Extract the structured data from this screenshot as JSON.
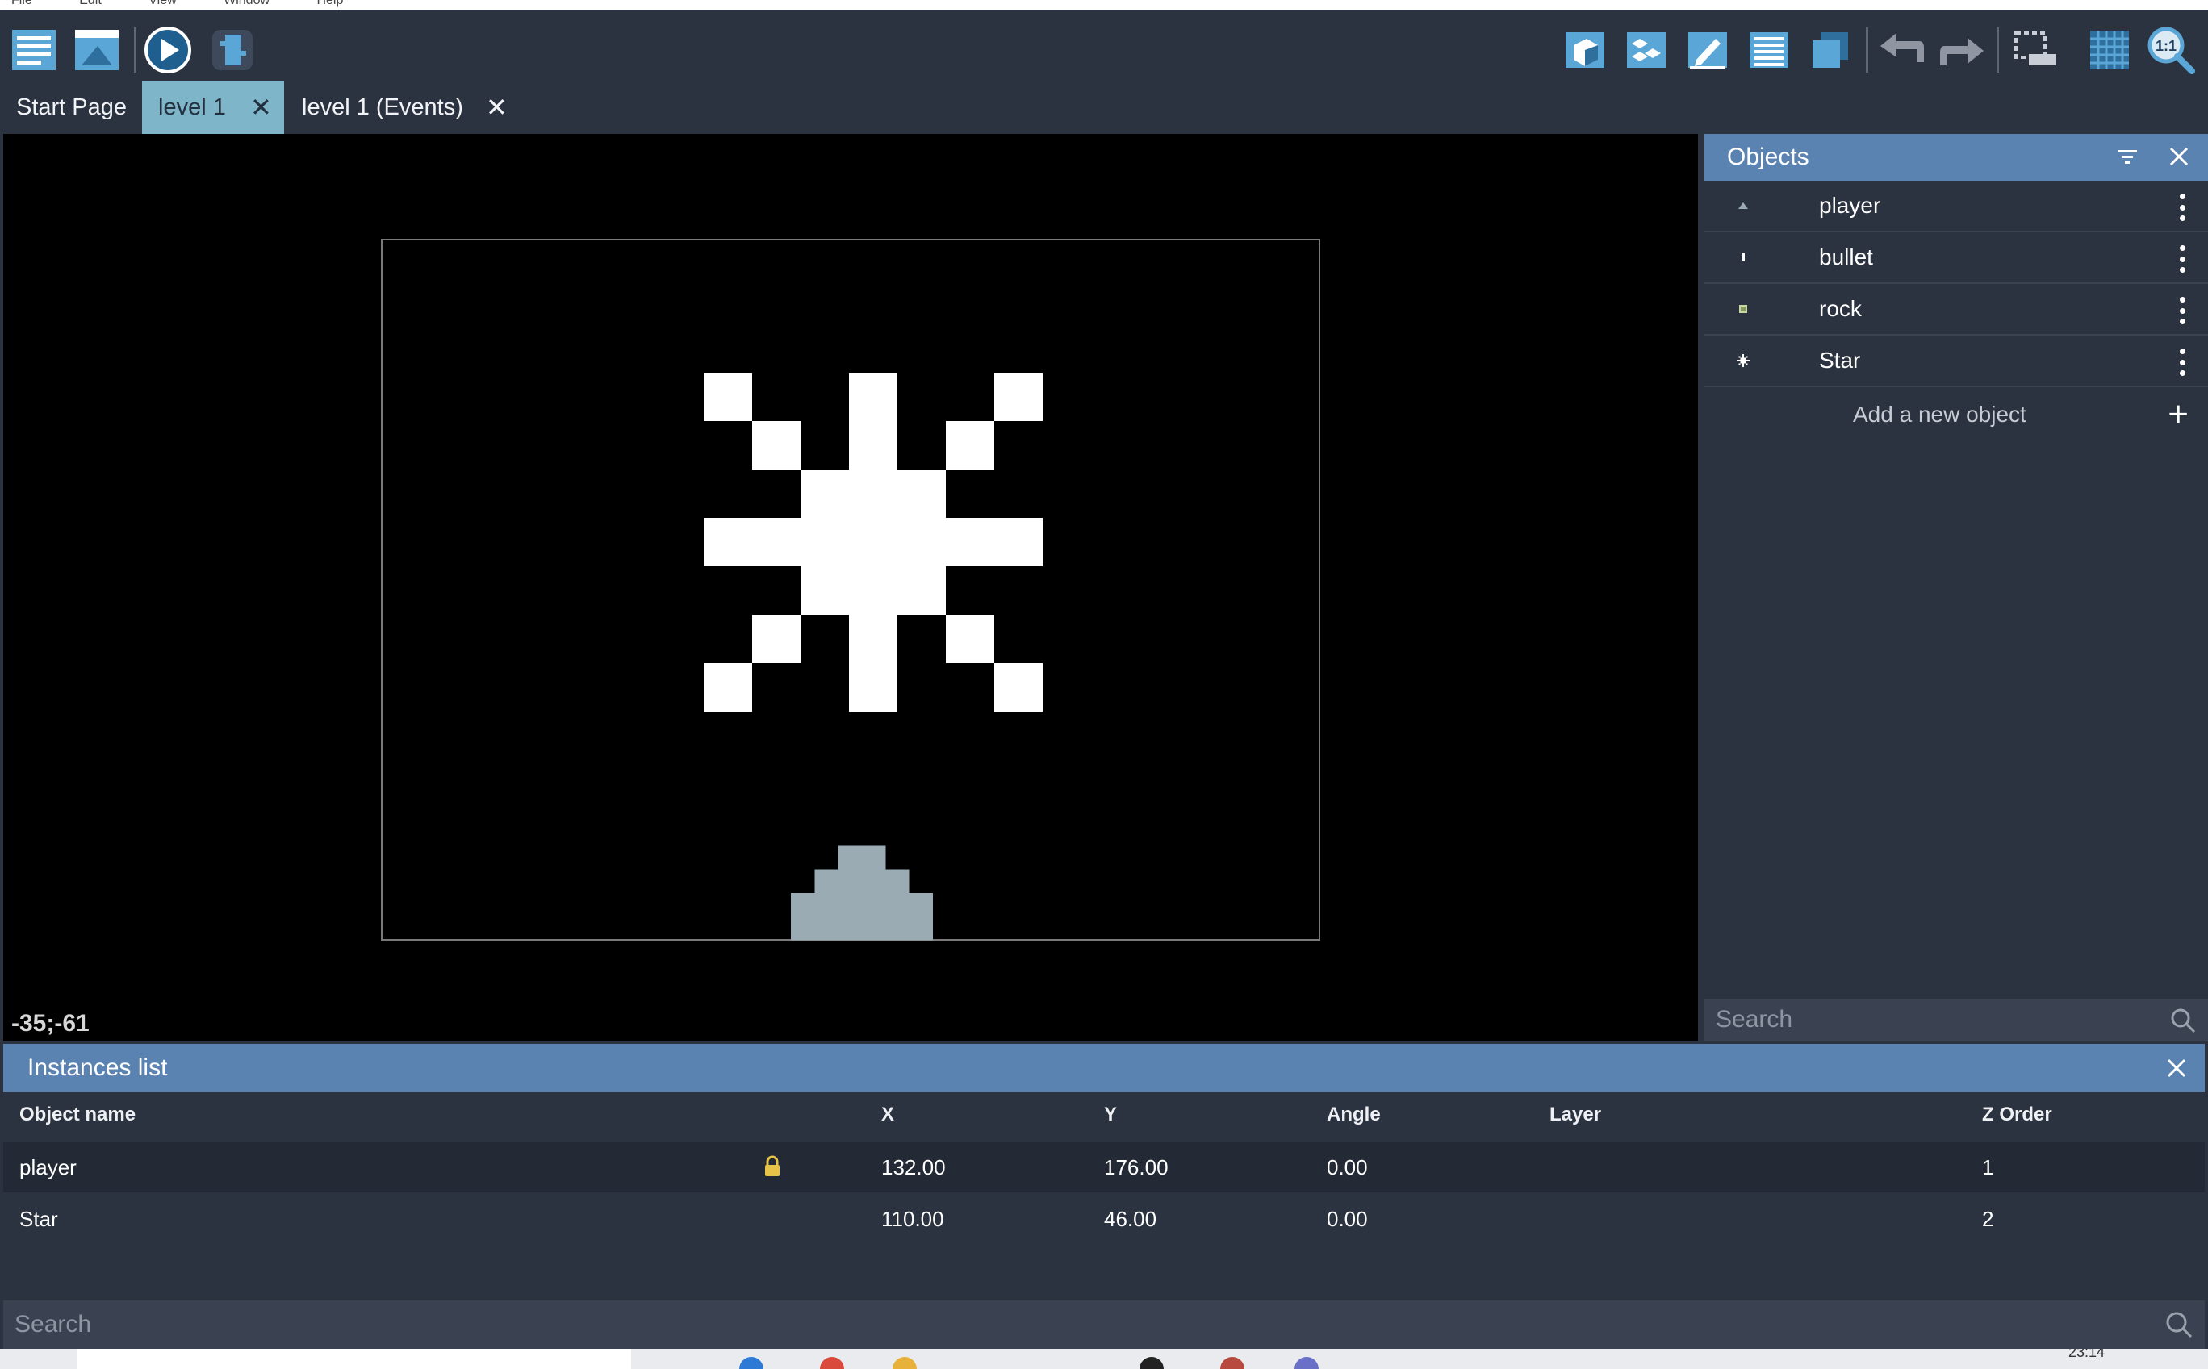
{
  "menu": [
    "File",
    "Edit",
    "View",
    "Window",
    "Help"
  ],
  "toolbar": {
    "left_icons": [
      "project-manager-icon",
      "scene-properties-icon",
      "preview-icon",
      "debugger-icon"
    ],
    "right_icons": [
      "objects-panel-icon",
      "object-groups-icon",
      "properties-icon",
      "instances-list-icon",
      "layers-icon",
      "undo-icon",
      "redo-icon",
      "instance-editor-icon",
      "grid-icon",
      "zoom-icon"
    ],
    "zoom_label": "1:1"
  },
  "tabs": [
    {
      "label": "Start Page",
      "closable": false,
      "active": false
    },
    {
      "label": "level 1",
      "closable": true,
      "active": true
    },
    {
      "label": "level 1 (Events)",
      "closable": true,
      "active": false
    }
  ],
  "tab_close_glyph": "✕",
  "canvas": {
    "cursor_coords": "-35;-61"
  },
  "objects_panel": {
    "title": "Objects",
    "items": [
      {
        "name": "player",
        "thumb": "player-thumb-icon"
      },
      {
        "name": "bullet",
        "thumb": "bullet-thumb-icon"
      },
      {
        "name": "rock",
        "thumb": "rock-thumb-icon"
      },
      {
        "name": "Star",
        "thumb": "star-thumb-icon"
      }
    ],
    "add_label": "Add a new object",
    "search_placeholder": "Search"
  },
  "instances_panel": {
    "title": "Instances list",
    "columns": [
      "Object name",
      "X",
      "Y",
      "Angle",
      "Layer",
      "Z Order"
    ],
    "rows": [
      {
        "name": "player",
        "locked": true,
        "x": "132.00",
        "y": "176.00",
        "angle": "0.00",
        "layer": "",
        "z": "1"
      },
      {
        "name": "Star",
        "locked": false,
        "x": "110.00",
        "y": "46.00",
        "angle": "0.00",
        "layer": "",
        "z": "2"
      }
    ],
    "search_placeholder": "Search"
  },
  "taskbar": {
    "clock": "23:14"
  },
  "colors": {
    "accent_header": "#5b83b1",
    "active_tab": "#7fb5c9",
    "background": "#2c3340",
    "player_sprite": "#9aabb3"
  }
}
